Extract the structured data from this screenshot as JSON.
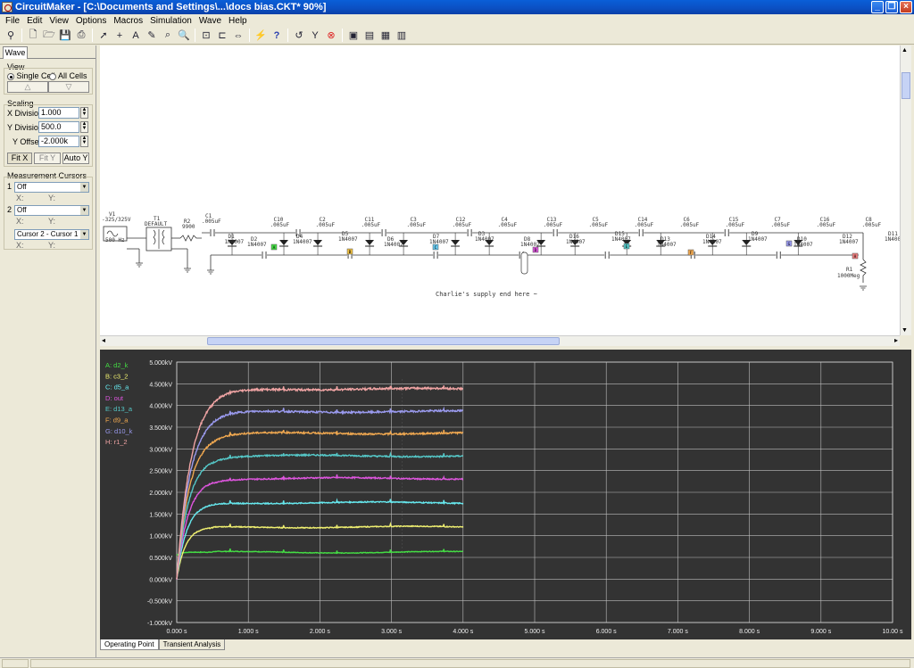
{
  "window": {
    "title": "CircuitMaker - [C:\\Documents and Settings\\...\\docs bias.CKT* 90%]"
  },
  "menu": [
    {
      "label": "File"
    },
    {
      "label": "Edit"
    },
    {
      "label": "View"
    },
    {
      "label": "Options"
    },
    {
      "label": "Macros"
    },
    {
      "label": "Simulation"
    },
    {
      "label": "Wave"
    },
    {
      "label": "Help"
    }
  ],
  "toolbar": {
    "icons": [
      "probe-icon",
      "new-file-icon",
      "open-folder-icon",
      "save-icon",
      "print-icon",
      "pointer-icon",
      "wire-icon",
      "text-icon",
      "probe-pen-icon",
      "zoom-icon",
      "search-icon",
      "zoom-fit-icon",
      "zoom-prev-icon",
      "pan-icon",
      "graph-icon",
      "help-icon",
      "undo-icon",
      "digital-probe-icon",
      "stop-icon",
      "window-tile-icon",
      "window-cascade-icon",
      "window-grid-icon",
      "window-split-icon"
    ]
  },
  "left_panel": {
    "tab": "Wave",
    "view_group": "View",
    "single_cell": "Single Cell",
    "all_cells": "All Cells",
    "scaling_group": "Scaling",
    "x_division_label": "X Division",
    "x_division_value": "1.000",
    "y_division_label": "Y Division",
    "y_division_value": "500.0",
    "y_offset_label": "Y Offset",
    "y_offset_value": "-2.000k",
    "fit_x": "Fit X",
    "fit_y": "Fit Y",
    "auto_y": "Auto Y",
    "cursors_group": "Measurement Cursors",
    "cursor1_num": "1",
    "cursor1_value": "Off",
    "cursor2_num": "2",
    "cursor2_value": "Off",
    "x_label": "X:",
    "y_label": "Y:",
    "diff_value": "Cursor 2 - Cursor 1"
  },
  "schematic": {
    "source_label": "V1",
    "source_value": "-325/325V",
    "source_freq": "500 Hz",
    "transformer_label": "T1",
    "transformer_value": "DEFAULT",
    "r2_label": "R2",
    "r2_value": "9900",
    "r1_label": "R1",
    "r1_value": "1000Meg",
    "note": "Charlie's supply end here ~",
    "diode_model": "1N4007",
    "cap_value": ".005uF",
    "components": [
      "C1",
      "D1",
      "D2",
      "C10",
      "D4",
      "C2",
      "D5",
      "C11",
      "D6",
      "C3",
      "D7",
      "C12",
      "D3",
      "C4",
      "D8",
      "C13",
      "D16",
      "C5",
      "D15",
      "C14",
      "D13",
      "C6",
      "D14",
      "C15",
      "D9",
      "C7",
      "D10",
      "C16",
      "D12",
      "C8",
      "D11"
    ],
    "probes": [
      "A",
      "B",
      "C",
      "D",
      "E",
      "F",
      "G",
      "H"
    ]
  },
  "wave": {
    "legend": [
      {
        "label": "A: d2_k",
        "color": "#44dd44"
      },
      {
        "label": "B: c3_2",
        "color": "#f0f070"
      },
      {
        "label": "C: d5_a",
        "color": "#66e8ee"
      },
      {
        "label": "D: out",
        "color": "#dd55dd"
      },
      {
        "label": "E: d13_a",
        "color": "#55c8c8"
      },
      {
        "label": "F: d9_a",
        "color": "#f0a850"
      },
      {
        "label": "G: d10_k",
        "color": "#9a9aee"
      },
      {
        "label": "H: r1_2",
        "color": "#f0a4a4"
      }
    ],
    "tabs": [
      "Operating Point",
      "Transient Analysis"
    ]
  },
  "chart_data": {
    "type": "line",
    "x_unit": "s",
    "y_unit": "kV",
    "xlim": [
      0,
      10
    ],
    "ylim": [
      -1,
      5
    ],
    "x_ticks": [
      "0.000 s",
      "1.000 s",
      "2.000 s",
      "3.000 s",
      "4.000 s",
      "5.000 s",
      "6.000 s",
      "7.000 s",
      "8.000 s",
      "9.000 s",
      "10.00 s"
    ],
    "y_ticks": [
      "5.000kV",
      "4.500kV",
      "4.000kV",
      "3.500kV",
      "3.000kV",
      "2.500kV",
      "2.000kV",
      "1.500kV",
      "1.000kV",
      "0.500kV",
      "0.000kV",
      "-0.500kV",
      "-1.000kV"
    ],
    "grid": true,
    "legend_position": "top-left",
    "series": [
      {
        "name": "A: d2_k",
        "color": "#44dd44",
        "start": 0.55,
        "final": 0.62,
        "tau": 0.05
      },
      {
        "name": "B: c3_2",
        "color": "#f0f070",
        "start": 0.0,
        "final": 1.2,
        "tau": 0.12
      },
      {
        "name": "C: d5_a",
        "color": "#66e8ee",
        "start": 0.0,
        "final": 1.76,
        "tau": 0.14
      },
      {
        "name": "D: out",
        "color": "#dd55dd",
        "start": 0.0,
        "final": 2.32,
        "tau": 0.16
      },
      {
        "name": "E: d13_a",
        "color": "#55c8c8",
        "start": 0.0,
        "final": 2.84,
        "tau": 0.17
      },
      {
        "name": "F: d9_a",
        "color": "#f0a850",
        "start": 0.0,
        "final": 3.36,
        "tau": 0.18
      },
      {
        "name": "G: d10_k",
        "color": "#9a9aee",
        "start": 0.0,
        "final": 3.86,
        "tau": 0.19
      },
      {
        "name": "H: r1_2",
        "color": "#f0a4a4",
        "start": 0.0,
        "final": 4.38,
        "tau": 0.2
      }
    ],
    "x_end": 4.0
  }
}
